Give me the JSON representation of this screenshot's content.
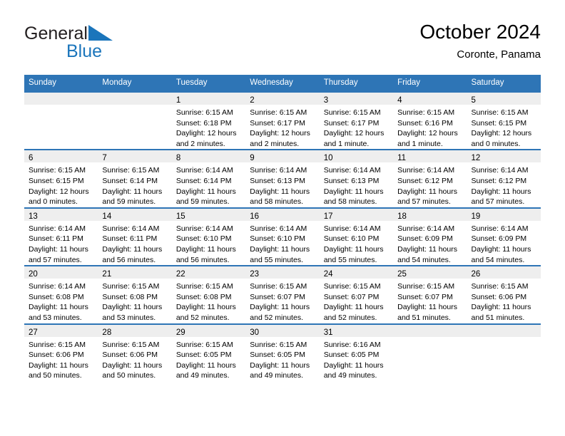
{
  "brand": {
    "line1": "General",
    "line2": "Blue",
    "triangle_color": "#1b75bb",
    "text_color": "#231f20",
    "blue_text_color": "#1b75bb"
  },
  "header": {
    "title": "October 2024",
    "subtitle": "Coronte, Panama"
  },
  "theme": {
    "header_blue": "#2e75b6",
    "row_separator": "#2e75b6",
    "daynum_band": "#eeeeee",
    "page_background": "#ffffff"
  },
  "calendar": {
    "weekday_headers": [
      "Sunday",
      "Monday",
      "Tuesday",
      "Wednesday",
      "Thursday",
      "Friday",
      "Saturday"
    ],
    "labels": {
      "sunrise": "Sunrise:",
      "sunset": "Sunset:",
      "daylight": "Daylight:"
    },
    "weeks": [
      [
        {
          "day": "",
          "lines": []
        },
        {
          "day": "",
          "lines": []
        },
        {
          "day": "1",
          "lines": [
            "Sunrise: 6:15 AM",
            "Sunset: 6:18 PM",
            "Daylight: 12 hours",
            "and 2 minutes."
          ]
        },
        {
          "day": "2",
          "lines": [
            "Sunrise: 6:15 AM",
            "Sunset: 6:17 PM",
            "Daylight: 12 hours",
            "and 2 minutes."
          ]
        },
        {
          "day": "3",
          "lines": [
            "Sunrise: 6:15 AM",
            "Sunset: 6:17 PM",
            "Daylight: 12 hours",
            "and 1 minute."
          ]
        },
        {
          "day": "4",
          "lines": [
            "Sunrise: 6:15 AM",
            "Sunset: 6:16 PM",
            "Daylight: 12 hours",
            "and 1 minute."
          ]
        },
        {
          "day": "5",
          "lines": [
            "Sunrise: 6:15 AM",
            "Sunset: 6:15 PM",
            "Daylight: 12 hours",
            "and 0 minutes."
          ]
        }
      ],
      [
        {
          "day": "6",
          "lines": [
            "Sunrise: 6:15 AM",
            "Sunset: 6:15 PM",
            "Daylight: 12 hours",
            "and 0 minutes."
          ]
        },
        {
          "day": "7",
          "lines": [
            "Sunrise: 6:15 AM",
            "Sunset: 6:14 PM",
            "Daylight: 11 hours",
            "and 59 minutes."
          ]
        },
        {
          "day": "8",
          "lines": [
            "Sunrise: 6:14 AM",
            "Sunset: 6:14 PM",
            "Daylight: 11 hours",
            "and 59 minutes."
          ]
        },
        {
          "day": "9",
          "lines": [
            "Sunrise: 6:14 AM",
            "Sunset: 6:13 PM",
            "Daylight: 11 hours",
            "and 58 minutes."
          ]
        },
        {
          "day": "10",
          "lines": [
            "Sunrise: 6:14 AM",
            "Sunset: 6:13 PM",
            "Daylight: 11 hours",
            "and 58 minutes."
          ]
        },
        {
          "day": "11",
          "lines": [
            "Sunrise: 6:14 AM",
            "Sunset: 6:12 PM",
            "Daylight: 11 hours",
            "and 57 minutes."
          ]
        },
        {
          "day": "12",
          "lines": [
            "Sunrise: 6:14 AM",
            "Sunset: 6:12 PM",
            "Daylight: 11 hours",
            "and 57 minutes."
          ]
        }
      ],
      [
        {
          "day": "13",
          "lines": [
            "Sunrise: 6:14 AM",
            "Sunset: 6:11 PM",
            "Daylight: 11 hours",
            "and 57 minutes."
          ]
        },
        {
          "day": "14",
          "lines": [
            "Sunrise: 6:14 AM",
            "Sunset: 6:11 PM",
            "Daylight: 11 hours",
            "and 56 minutes."
          ]
        },
        {
          "day": "15",
          "lines": [
            "Sunrise: 6:14 AM",
            "Sunset: 6:10 PM",
            "Daylight: 11 hours",
            "and 56 minutes."
          ]
        },
        {
          "day": "16",
          "lines": [
            "Sunrise: 6:14 AM",
            "Sunset: 6:10 PM",
            "Daylight: 11 hours",
            "and 55 minutes."
          ]
        },
        {
          "day": "17",
          "lines": [
            "Sunrise: 6:14 AM",
            "Sunset: 6:10 PM",
            "Daylight: 11 hours",
            "and 55 minutes."
          ]
        },
        {
          "day": "18",
          "lines": [
            "Sunrise: 6:14 AM",
            "Sunset: 6:09 PM",
            "Daylight: 11 hours",
            "and 54 minutes."
          ]
        },
        {
          "day": "19",
          "lines": [
            "Sunrise: 6:14 AM",
            "Sunset: 6:09 PM",
            "Daylight: 11 hours",
            "and 54 minutes."
          ]
        }
      ],
      [
        {
          "day": "20",
          "lines": [
            "Sunrise: 6:14 AM",
            "Sunset: 6:08 PM",
            "Daylight: 11 hours",
            "and 53 minutes."
          ]
        },
        {
          "day": "21",
          "lines": [
            "Sunrise: 6:15 AM",
            "Sunset: 6:08 PM",
            "Daylight: 11 hours",
            "and 53 minutes."
          ]
        },
        {
          "day": "22",
          "lines": [
            "Sunrise: 6:15 AM",
            "Sunset: 6:08 PM",
            "Daylight: 11 hours",
            "and 52 minutes."
          ]
        },
        {
          "day": "23",
          "lines": [
            "Sunrise: 6:15 AM",
            "Sunset: 6:07 PM",
            "Daylight: 11 hours",
            "and 52 minutes."
          ]
        },
        {
          "day": "24",
          "lines": [
            "Sunrise: 6:15 AM",
            "Sunset: 6:07 PM",
            "Daylight: 11 hours",
            "and 52 minutes."
          ]
        },
        {
          "day": "25",
          "lines": [
            "Sunrise: 6:15 AM",
            "Sunset: 6:07 PM",
            "Daylight: 11 hours",
            "and 51 minutes."
          ]
        },
        {
          "day": "26",
          "lines": [
            "Sunrise: 6:15 AM",
            "Sunset: 6:06 PM",
            "Daylight: 11 hours",
            "and 51 minutes."
          ]
        }
      ],
      [
        {
          "day": "27",
          "lines": [
            "Sunrise: 6:15 AM",
            "Sunset: 6:06 PM",
            "Daylight: 11 hours",
            "and 50 minutes."
          ]
        },
        {
          "day": "28",
          "lines": [
            "Sunrise: 6:15 AM",
            "Sunset: 6:06 PM",
            "Daylight: 11 hours",
            "and 50 minutes."
          ]
        },
        {
          "day": "29",
          "lines": [
            "Sunrise: 6:15 AM",
            "Sunset: 6:05 PM",
            "Daylight: 11 hours",
            "and 49 minutes."
          ]
        },
        {
          "day": "30",
          "lines": [
            "Sunrise: 6:15 AM",
            "Sunset: 6:05 PM",
            "Daylight: 11 hours",
            "and 49 minutes."
          ]
        },
        {
          "day": "31",
          "lines": [
            "Sunrise: 6:16 AM",
            "Sunset: 6:05 PM",
            "Daylight: 11 hours",
            "and 49 minutes."
          ]
        },
        {
          "day": "",
          "lines": []
        },
        {
          "day": "",
          "lines": []
        }
      ]
    ]
  }
}
